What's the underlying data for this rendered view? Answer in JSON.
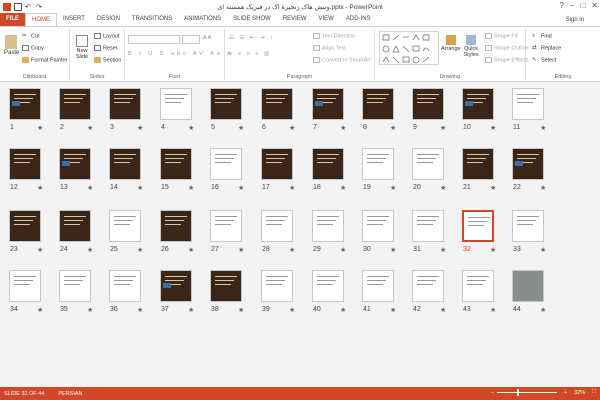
{
  "window": {
    "title": "وتیش هاک زنجیرۀ اک در فیزیک همسته ای.pptx - PowerPoint",
    "signin": "Sign in",
    "help": "?"
  },
  "tabs": [
    "FILE",
    "HOME",
    "INSERT",
    "DESIGN",
    "TRANSITIONS",
    "ANIMATIONS",
    "SLIDE SHOW",
    "REVIEW",
    "VIEW",
    "ADD-INS"
  ],
  "ribbon": {
    "clipboard": {
      "label": "Clipboard",
      "paste": "Paste",
      "cut": "Cut",
      "copy": "Copy",
      "format_painter": "Format Painter"
    },
    "slides": {
      "label": "Slides",
      "new_slide": "New Slide",
      "layout": "Layout",
      "reset": "Reset",
      "section": "Section"
    },
    "font": {
      "label": "Font"
    },
    "paragraph": {
      "label": "Paragraph",
      "text_direction": "Text Direction",
      "align_text": "Align Text",
      "convert": "Convert to SmartArt"
    },
    "drawing": {
      "label": "Drawing",
      "arrange": "Arrange",
      "quick_styles": "Quick Styles",
      "shape_fill": "Shape Fill",
      "shape_outline": "Shape Outline",
      "shape_effects": "Shape Effects"
    },
    "editing": {
      "label": "Editing",
      "find": "Find",
      "replace": "Replace",
      "select": "Select"
    }
  },
  "slides": [
    {
      "n": "1",
      "style": "dark"
    },
    {
      "n": "2",
      "style": "dark"
    },
    {
      "n": "3",
      "style": "dark"
    },
    {
      "n": "4",
      "style": "white"
    },
    {
      "n": "5",
      "style": "dark"
    },
    {
      "n": "6",
      "style": "dark"
    },
    {
      "n": "7",
      "style": "dark"
    },
    {
      "n": "8",
      "style": "dark"
    },
    {
      "n": "9",
      "style": "dark"
    },
    {
      "n": "10",
      "style": "dark"
    },
    {
      "n": "11",
      "style": "white"
    },
    {
      "n": "12",
      "style": "dark"
    },
    {
      "n": "13",
      "style": "dark"
    },
    {
      "n": "14",
      "style": "dark"
    },
    {
      "n": "15",
      "style": "dark"
    },
    {
      "n": "16",
      "style": "white"
    },
    {
      "n": "17",
      "style": "dark"
    },
    {
      "n": "18",
      "style": "dark"
    },
    {
      "n": "19",
      "style": "white"
    },
    {
      "n": "20",
      "style": "white"
    },
    {
      "n": "21",
      "style": "dark"
    },
    {
      "n": "22",
      "style": "dark"
    },
    {
      "n": "23",
      "style": "dark"
    },
    {
      "n": "24",
      "style": "dark"
    },
    {
      "n": "25",
      "style": "white"
    },
    {
      "n": "26",
      "style": "dark"
    },
    {
      "n": "27",
      "style": "white"
    },
    {
      "n": "28",
      "style": "white"
    },
    {
      "n": "29",
      "style": "white"
    },
    {
      "n": "30",
      "style": "white"
    },
    {
      "n": "31",
      "style": "white"
    },
    {
      "n": "32",
      "style": "white",
      "selected": true
    },
    {
      "n": "33",
      "style": "white"
    },
    {
      "n": "34",
      "style": "white"
    },
    {
      "n": "35",
      "style": "white"
    },
    {
      "n": "36",
      "style": "white"
    },
    {
      "n": "37",
      "style": "dark"
    },
    {
      "n": "38",
      "style": "dark"
    },
    {
      "n": "39",
      "style": "white"
    },
    {
      "n": "40",
      "style": "white"
    },
    {
      "n": "41",
      "style": "white"
    },
    {
      "n": "42",
      "style": "white"
    },
    {
      "n": "43",
      "style": "white"
    },
    {
      "n": "44",
      "style": "photo"
    }
  ],
  "status": {
    "slide": "SLIDE 32 OF 44",
    "language": "PERSIAN",
    "zoom": "32%"
  },
  "colors": {
    "accent": "#d24726",
    "thumb_dark": "#3a2618"
  }
}
